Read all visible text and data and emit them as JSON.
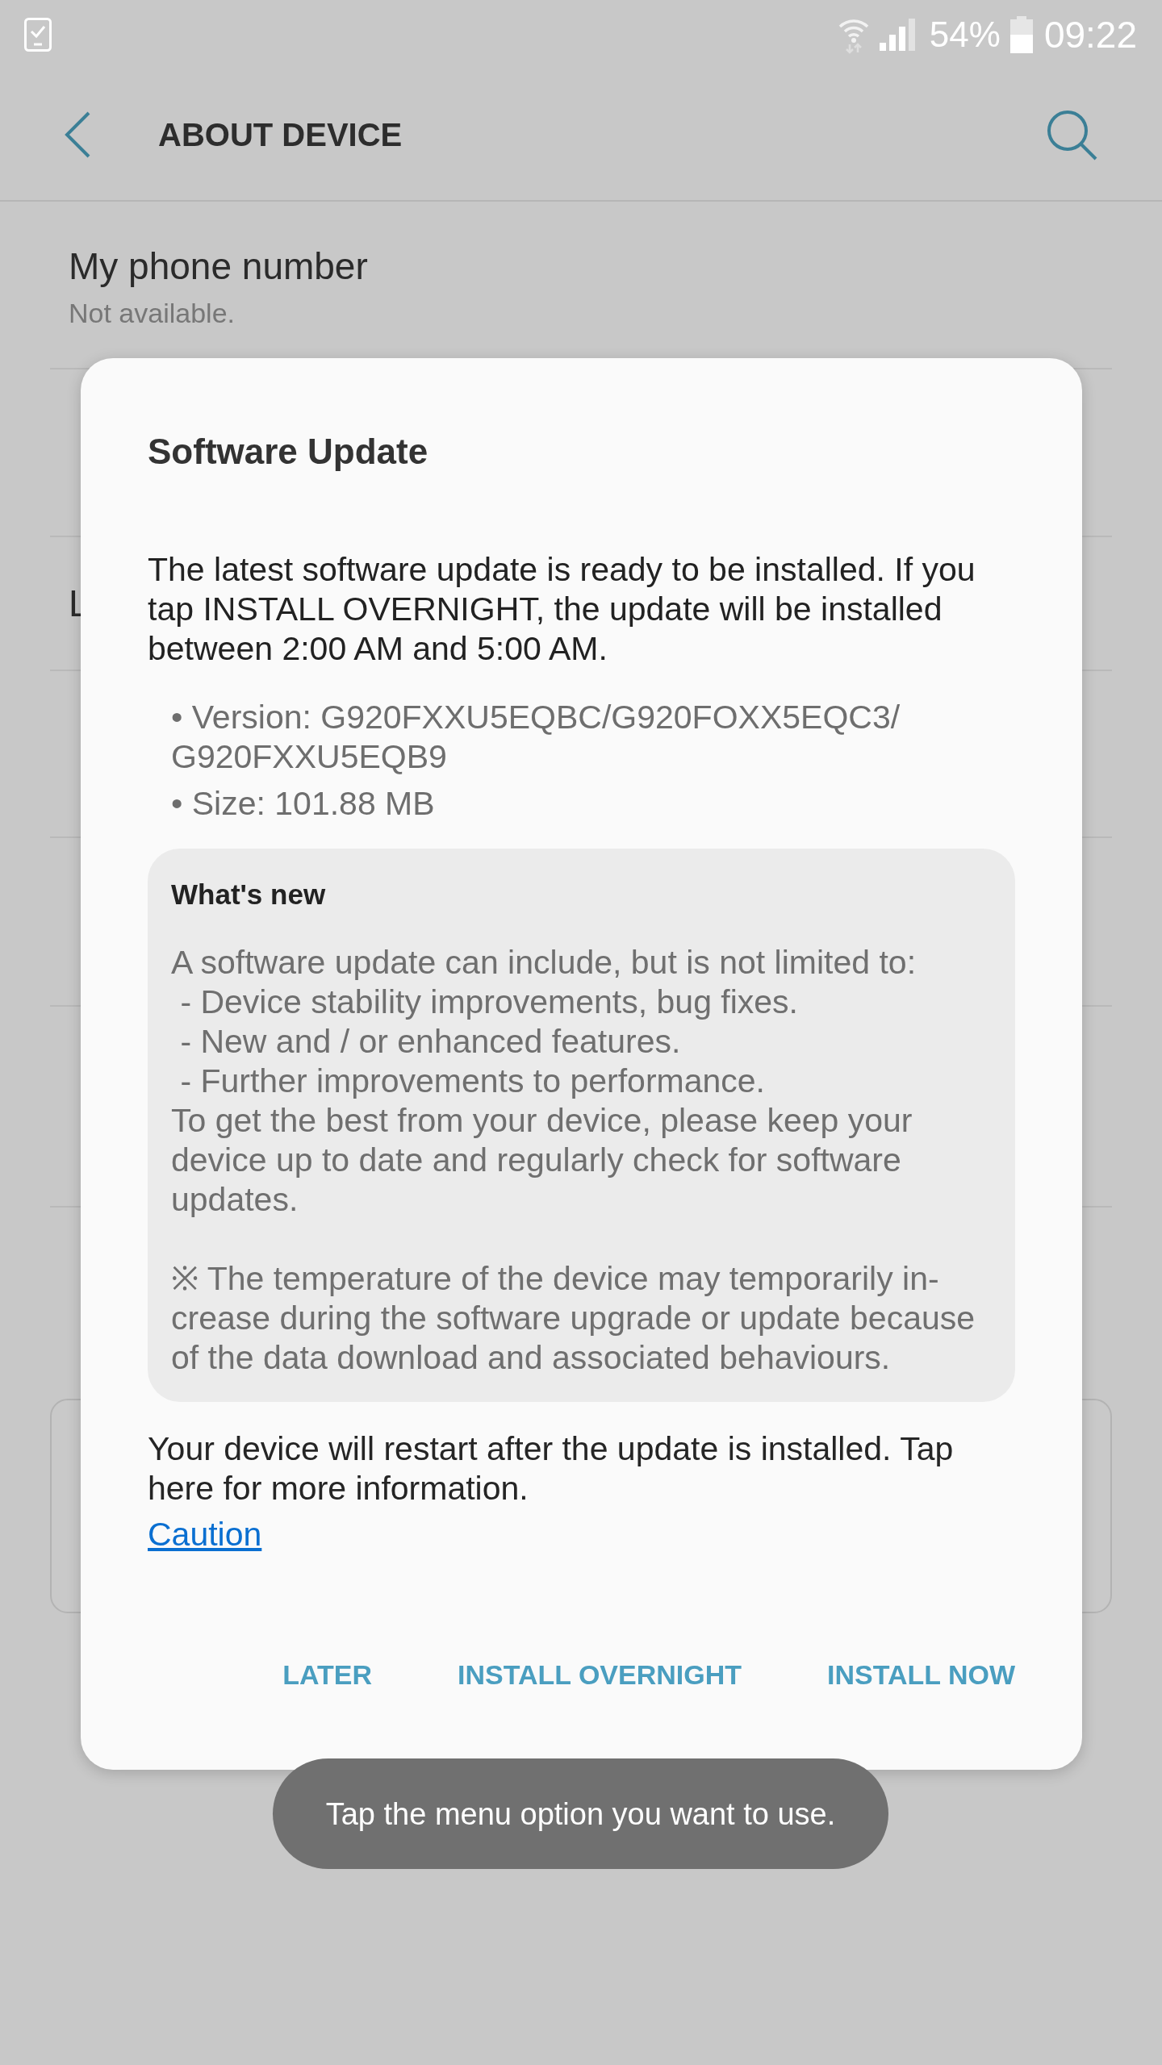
{
  "status_bar": {
    "battery": "54%",
    "time": "09:22"
  },
  "app_bar": {
    "title": "ABOUT DEVICE"
  },
  "settings_list": [
    {
      "title": "My phone number",
      "subtitle": "Not available."
    },
    {
      "title": "L"
    }
  ],
  "dialog": {
    "title": "Software Update",
    "message": "The latest software update is ready to be installed. If you tap INSTALL OVERNIGHT, the update will be installed between 2:00 AM and 5:00 AM.",
    "details": [
      "• Version: G920FXXU5EQBC/G920FOXX5EQC3/G920FXXU5EQB9",
      "• Size: 101.88 MB"
    ],
    "whats_new": {
      "title": "What's new",
      "description": "A software update can include, but is not limited to:\n - Device stability improvements, bug fixes.\n - New and / or enhanced features.\n - Further improvements to performance.\nTo get the best from your device, please keep your device up to date and regularly check for software updates.",
      "note": "※ The temperature of the device may temporarily in-crease during the software upgrade or update because of the data download and associated behaviours."
    },
    "footer": "Your device will restart after the update is installed. Tap here for more information.",
    "link": "Caution",
    "buttons": [
      "LATER",
      "INSTALL OVERNIGHT",
      "INSTALL NOW"
    ]
  },
  "toast": "Tap the menu option you want to use."
}
